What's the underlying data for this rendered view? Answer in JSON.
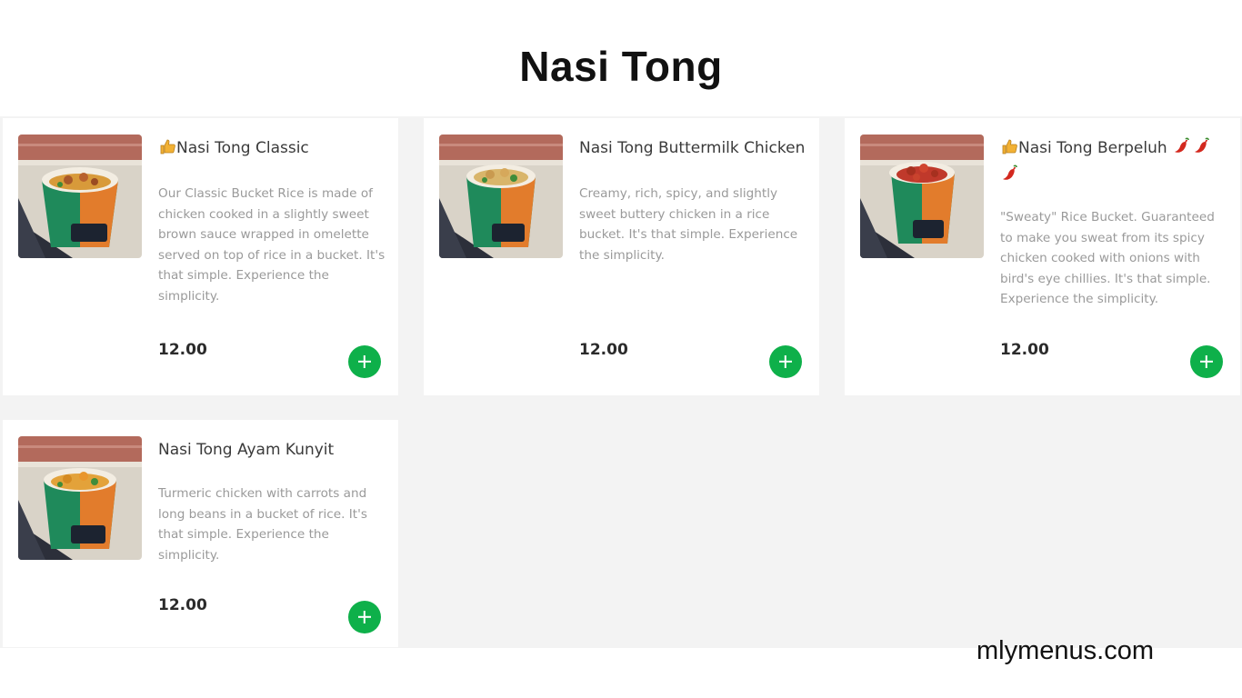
{
  "page": {
    "title": "Nasi Tong"
  },
  "items": [
    {
      "name": "Nasi Tong Classic",
      "description": "Our Classic Bucket Rice is made of chicken cooked in a slightly sweet brown sauce wrapped in omelette served on top of rice in a bucket. It's that simple. Experience the simplicity.",
      "price": "12.00",
      "icons": [
        "thumbs-up-icon"
      ]
    },
    {
      "name": "Nasi Tong Buttermilk Chicken",
      "description": "Creamy, rich, spicy, and slightly sweet buttery chicken in a rice bucket. It's that simple. Experience the simplicity.",
      "price": "12.00",
      "icons": []
    },
    {
      "name": "Nasi Tong Berpeluh",
      "description": "\"Sweaty\" Rice Bucket. Guaranteed to make you sweat from its spicy chicken cooked with onions with bird's eye chillies. It's that simple. Experience the simplicity.",
      "price": "12.00",
      "icons": [
        "thumbs-up-icon",
        "chili-pepper-icon",
        "chili-pepper-icon",
        "chili-pepper-icon"
      ]
    },
    {
      "name": "Nasi Tong Ayam Kunyit",
      "description": "Turmeric chicken with carrots and long beans in a bucket of rice. It's that simple. Experience the simplicity.",
      "price": "12.00",
      "icons": []
    }
  ],
  "watermark": {
    "text": "mlymenus.com"
  },
  "colors": {
    "accent_green": "#0eb04a",
    "background": "#f3f3f3",
    "card": "#ffffff"
  }
}
